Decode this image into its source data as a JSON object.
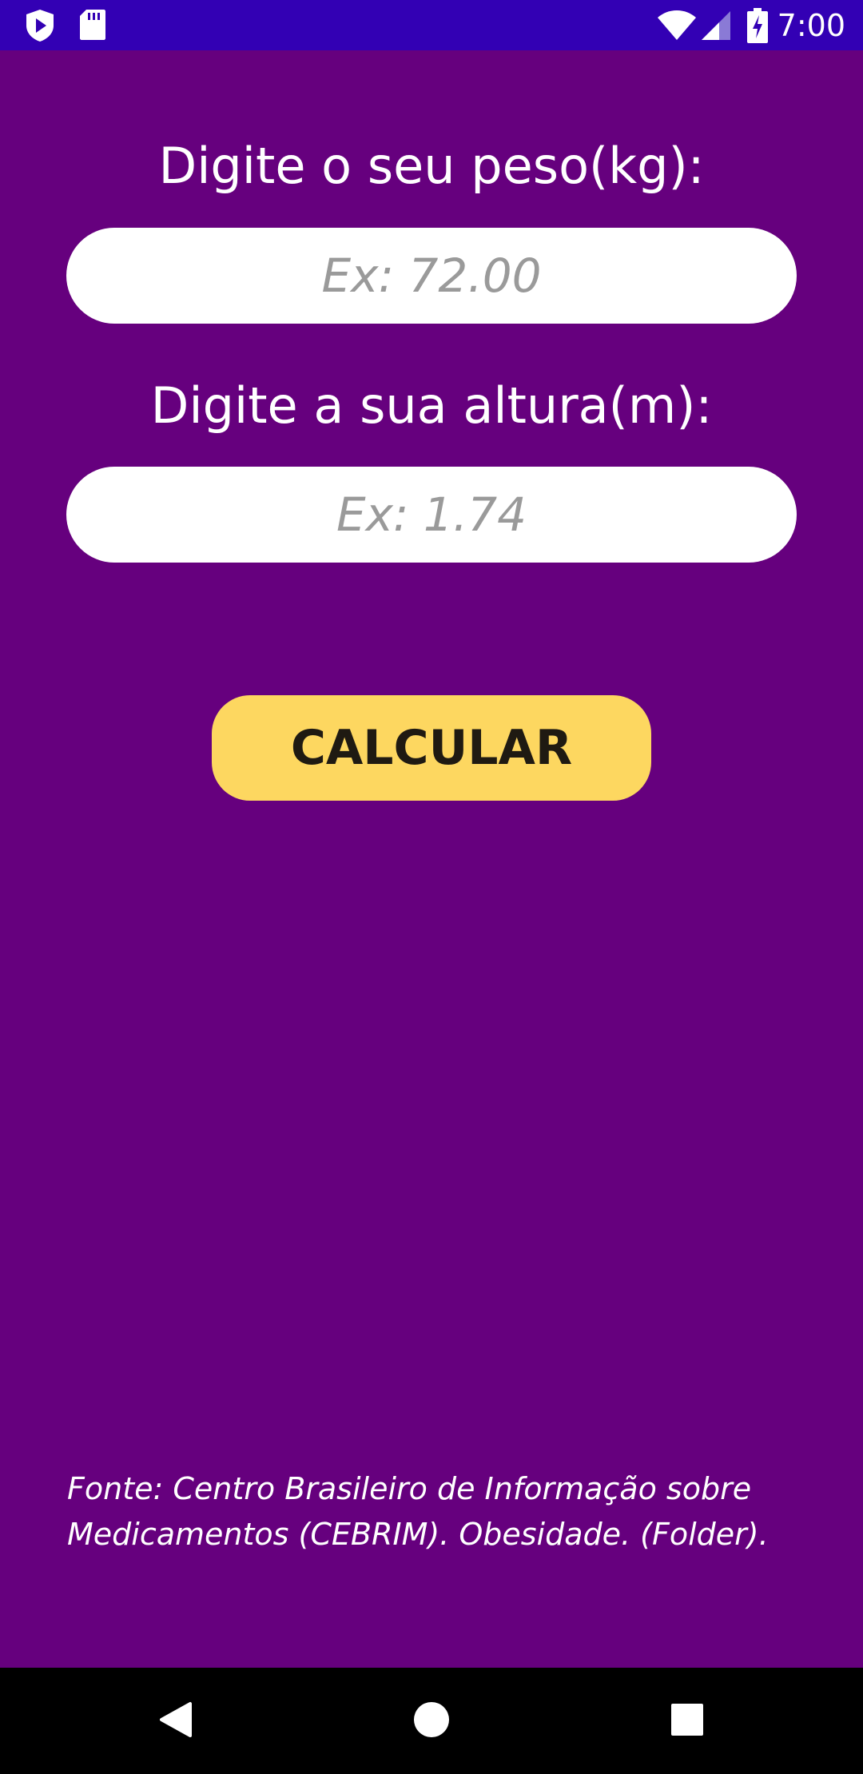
{
  "status_bar": {
    "time": "7:00",
    "icons": [
      "shield-play-icon",
      "sd-card-icon",
      "wifi-icon",
      "cellular-signal-icon",
      "battery-charging-icon"
    ],
    "background": "#3300b4"
  },
  "form": {
    "weight_label": "Digite o seu peso(kg):",
    "weight_placeholder": "Ex: 72.00",
    "weight_value": "",
    "height_label": "Digite a sua altura(m):",
    "height_placeholder": "Ex: 1.74",
    "height_value": "",
    "calculate_label": "CALCULAR"
  },
  "footer": {
    "source": "Fonte: Centro Brasileiro de Informação sobre Medicamentos (CEBRIM). Obesidade. (Folder)."
  },
  "nav_bar": {
    "buttons": [
      "back-icon",
      "home-icon",
      "recents-icon"
    ]
  },
  "colors": {
    "background": "#66007e",
    "button": "#fdd760",
    "button_text": "#1f1a12",
    "input_background": "#ffffff",
    "placeholder": "#9a9a9a"
  }
}
